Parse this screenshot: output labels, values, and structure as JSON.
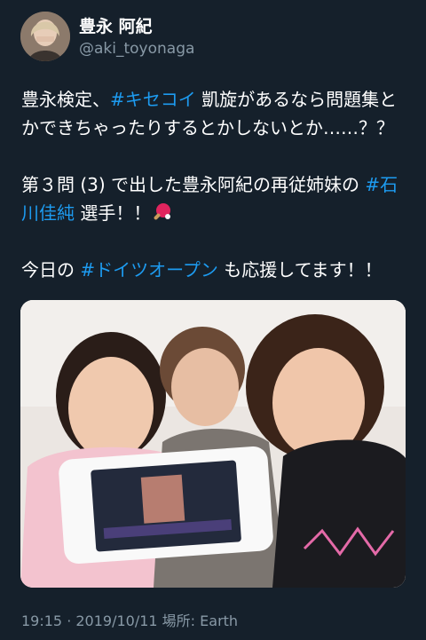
{
  "tweet": {
    "author": {
      "display_name": "豊永 阿紀",
      "handle": "@aki_toyonaga"
    },
    "paragraph1": {
      "pre": "豊永検定、",
      "hashtag1": "#キセコイ",
      "post": " 凱旋があるなら問題集とかできちゃったりするとかしないとか……？？"
    },
    "paragraph2": {
      "pre": "第３問 (3) で出した豊永阿紀の再従姉妹の ",
      "hashtag1": "#石川佳純",
      "post": " 選手！！",
      "emoji": "ping-pong-paddle-icon"
    },
    "paragraph3": {
      "pre": "今日の ",
      "hashtag1": "#ドイツオープン",
      "post": " も応援してます！！"
    },
    "media": {
      "alt": "photo"
    },
    "meta": "19:15 · 2019/10/11 場所: Earth"
  },
  "colors": {
    "background": "#15202b",
    "text": "#ffffff",
    "secondary": "#8899a6",
    "hashtag": "#1d9bf0"
  }
}
